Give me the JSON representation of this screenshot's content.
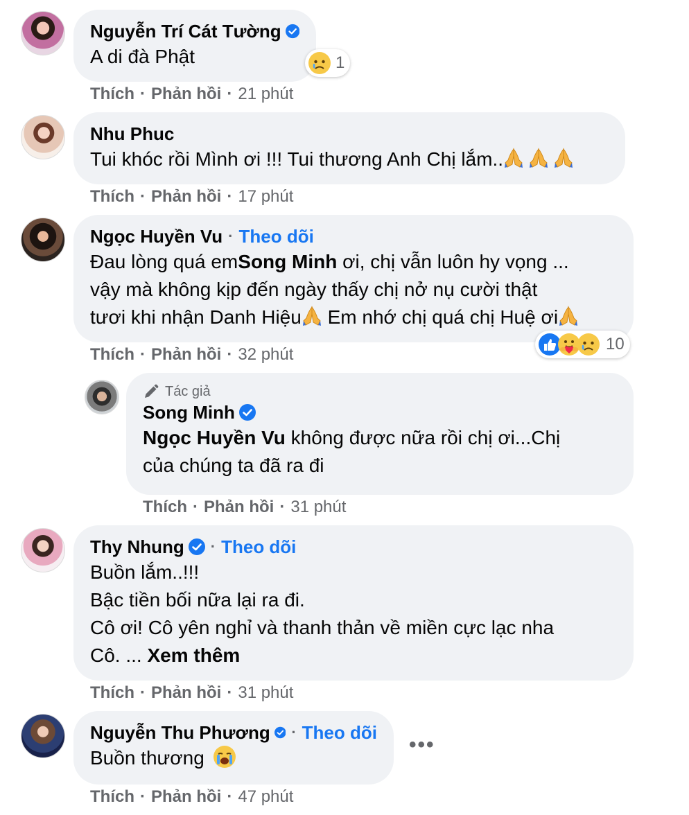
{
  "comments": [
    {
      "name": "Nguyễn Trí Cát Tường",
      "verified": true,
      "text": "A di đà Phật",
      "reaction_count": "1",
      "like": "Thích",
      "reply": "Phản hồi",
      "time": "21 phút"
    },
    {
      "name": "Nhu Phuc",
      "text": "Tui khóc rồi Mình ơi !!! Tui thương Anh Chị lắm..",
      "like": "Thích",
      "reply": "Phản hồi",
      "time": "17 phút"
    },
    {
      "name": "Ngọc Huyền Vu",
      "follow": "Theo dõi",
      "text_a": "Đau lòng quá em",
      "mention": "Song Minh",
      "text_b": " ơi, chị vẫn luôn hy vọng ...",
      "line2": "vậy mà không kịp đến ngày thấy chị nở nụ cười thật",
      "line3_a": "tươi khi nhận Danh Hiệu",
      "line3_b": " Em nhớ chị quá chị Huệ ơi",
      "reaction_count": "10",
      "like": "Thích",
      "reply": "Phản hồi",
      "time": "32 phút"
    },
    {
      "author_tag": "Tác giả",
      "name": "Song Minh",
      "verified": true,
      "mention": "Ngọc Huyền Vu",
      "text_a": " không được nữa rồi chị ơi...Chị",
      "line2": "của chúng ta đã ra đi",
      "like": "Thích",
      "reply": "Phản hồi",
      "time": "31 phút"
    },
    {
      "name": "Thy Nhung",
      "verified": true,
      "follow": "Theo dõi",
      "line1": "Buồn lắm..!!!",
      "line2": "Bậc tiền bối nữa lại ra đi.",
      "line3": "Cô ơi! Cô yên nghỉ và thanh thản về miền cực lạc nha",
      "line4": "Cô. ... ",
      "see_more": "Xem thêm",
      "like": "Thích",
      "reply": "Phản hồi",
      "time": "31 phút"
    },
    {
      "name": "Nguyễn Thu Phương",
      "verified": true,
      "follow": "Theo dõi",
      "text": "Buồn thương",
      "like": "Thích",
      "reply": "Phản hồi",
      "time": "47 phút"
    }
  ],
  "icons": {
    "verified": "verified-badge-icon",
    "pray": "folded-hands-emoji",
    "sad": "sad-face-emoji",
    "like": "like-icon",
    "care": "care-emoji",
    "crying": "crying-face-emoji",
    "pencil": "pencil-icon",
    "more": "more-options-icon"
  },
  "colors": {
    "bubble": "#f0f2f5",
    "link": "#1877f2",
    "meta": "#65676b"
  }
}
